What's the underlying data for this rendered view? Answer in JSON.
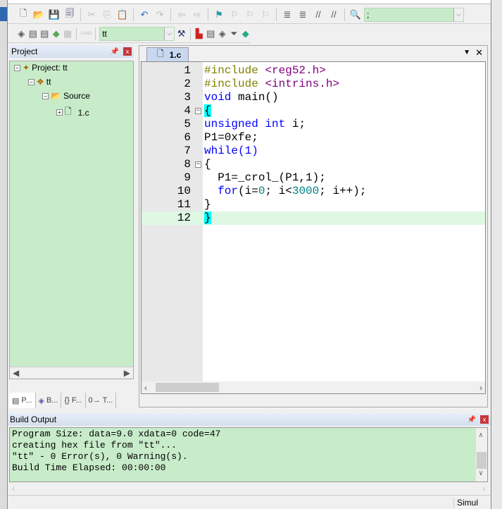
{
  "toolbar1": {
    "find_combo_value": ";"
  },
  "toolbar2": {
    "target_combo_value": "tt",
    "load_label": "LOAD"
  },
  "project_panel": {
    "title": "Project",
    "tree": [
      {
        "label": "Project: tt"
      },
      {
        "label": "tt"
      },
      {
        "label": "Source"
      },
      {
        "label": "1.c"
      }
    ],
    "tabs": [
      {
        "label": "P..."
      },
      {
        "label": "B..."
      },
      {
        "label": "F..."
      },
      {
        "label": "T..."
      }
    ]
  },
  "editor": {
    "tab": "1.c",
    "lines": [
      {
        "n": "1"
      },
      {
        "n": "2"
      },
      {
        "n": "3"
      },
      {
        "n": "4"
      },
      {
        "n": "5"
      },
      {
        "n": "6"
      },
      {
        "n": "7"
      },
      {
        "n": "8"
      },
      {
        "n": "9"
      },
      {
        "n": "10"
      },
      {
        "n": "11"
      },
      {
        "n": "12"
      }
    ],
    "code": [
      "#include <reg52.h>",
      "#include <intrins.h>",
      "void main()",
      "{",
      "unsigned int i;",
      "P1=0xfe;",
      "while(1)",
      "{",
      "  P1=_crol_(P1,1);",
      "  for(i=0; i<3000; i++);",
      "}",
      "}"
    ]
  },
  "build_output": {
    "title": "Build Output",
    "lines": [
      "Program Size: data=9.0 xdata=0 code=47",
      "creating hex file from \"tt\"...",
      "\"tt\" - 0 Error(s), 0 Warning(s).",
      "Build Time Elapsed:  00:00:00"
    ]
  },
  "status": {
    "mode": "Simul"
  },
  "colors": {
    "panel_bg": "#c8ebc9",
    "keyword": "#0000ff",
    "preprocessor": "#808000",
    "number": "#008080",
    "brace_highlight": "#00ffff"
  }
}
